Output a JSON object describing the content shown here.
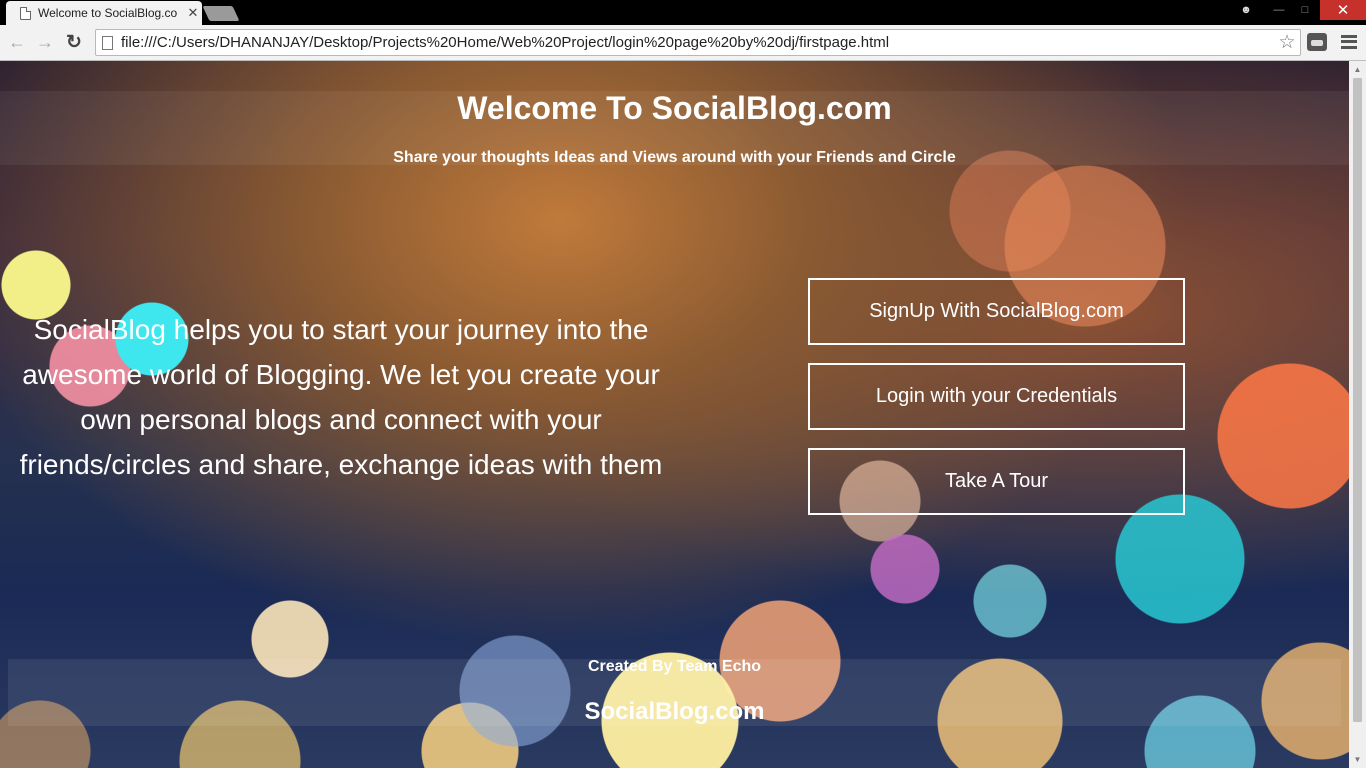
{
  "browser": {
    "tab_title": "Welcome to SocialBlog.co",
    "tab_close": "✕",
    "url": "file:///C:/Users/DHANANJAY/Desktop/Projects%20Home/Web%20Project/login%20page%20by%20dj/firstpage.html"
  },
  "page": {
    "title": "Welcome To SocialBlog.com",
    "subtitle": "Share your thoughts Ideas and Views around with your Friends and Circle",
    "intro": "SocialBlog helps you to start your journey into the awesome world of Blogging. We let you create your own personal blogs and connect with your friends/circles and share, exchange ideas with them",
    "buttons": {
      "signup": "SignUp With SocialBlog.com",
      "login": "Login with your Credentials",
      "tour": "Take A Tour"
    },
    "footer": {
      "credit": "Created By Team Echo",
      "brand": "SocialBlog.com"
    }
  },
  "icons": {
    "back": "back-arrow-icon",
    "forward": "forward-arrow-icon",
    "reload": "reload-icon",
    "bookmark": "star-icon",
    "menu": "hamburger-menu-icon"
  },
  "colors": {
    "button_border": "#ffffff",
    "text": "#ffffff",
    "close_button": "#c7312b"
  }
}
